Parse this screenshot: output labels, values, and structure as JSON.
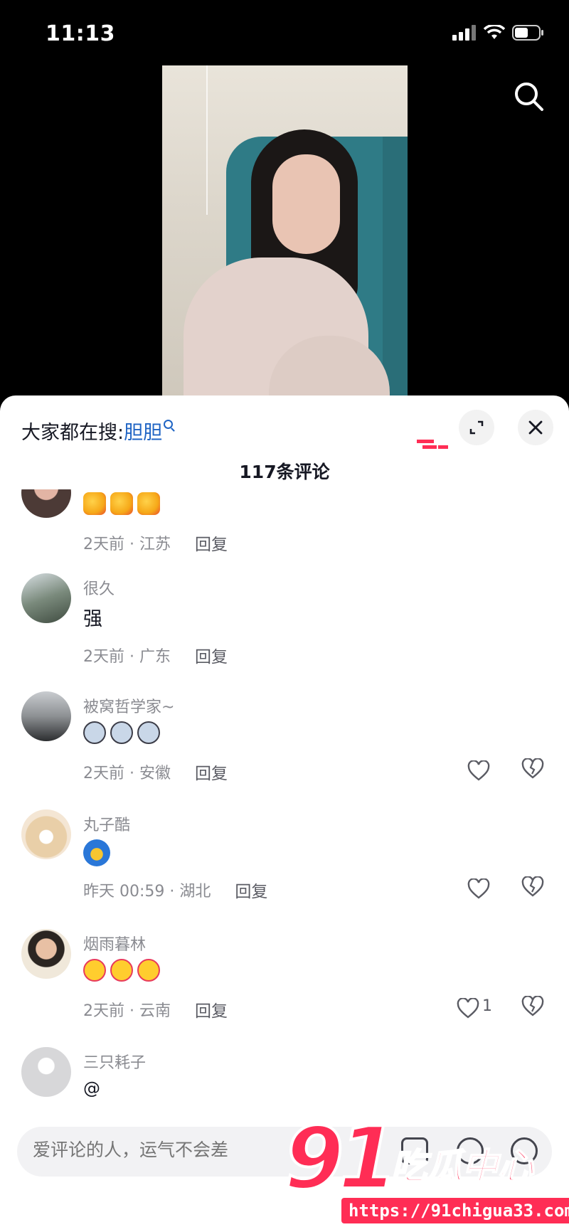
{
  "status_bar": {
    "time": "11:13"
  },
  "video": {
    "description_hidden": ""
  },
  "sheet": {
    "hot_search_prefix": "大家都在搜:",
    "hot_search_keyword": "胆胆",
    "comment_count_title": "117条评论"
  },
  "comments": [
    {
      "nick": "",
      "meta": "2天前 · 江苏",
      "reply": "回复"
    },
    {
      "nick": "很久",
      "text": "强",
      "meta": "2天前 · 广东",
      "reply": "回复"
    },
    {
      "nick": "被窝哲学家~",
      "meta": "2天前 · 安徽",
      "reply": "回复"
    },
    {
      "nick": "丸子酷",
      "meta": "昨天 00:59 · 湖北",
      "reply": "回复"
    },
    {
      "nick": "烟雨暮林",
      "meta": "2天前 · 云南",
      "reply": "回复",
      "likes": "1"
    },
    {
      "nick": "三只耗子",
      "text": "@"
    }
  ],
  "input": {
    "placeholder": "爱评论的人，运气不会差"
  },
  "watermark": {
    "number": "91",
    "brand": "吃瓜中心",
    "url": "https://91chigua33.com"
  },
  "colors": {
    "accent": "#ff2d55",
    "link": "#1f64c4",
    "sheet_bg": "#ffffff",
    "meta_gray": "#8a8b91"
  },
  "icons": [
    "signal-icon",
    "wifi-icon",
    "battery-icon",
    "search-icon",
    "expand-icon",
    "close-icon",
    "heart-icon",
    "broken-heart-icon",
    "image-icon",
    "at-icon",
    "emoji-icon"
  ]
}
